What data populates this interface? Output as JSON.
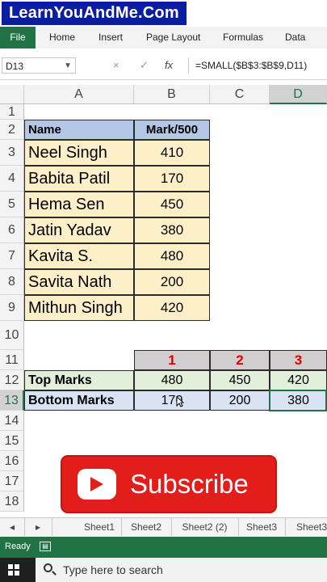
{
  "brand": "LearnYouAndMe.Com",
  "ribbon_tabs": [
    "File",
    "Home",
    "Insert",
    "Page Layout",
    "Formulas",
    "Data"
  ],
  "name_box": "D13",
  "formula_icons": {
    "cancel": "×",
    "enter": "✓",
    "function": "fx"
  },
  "formula": "=SMALL($B$3:$B$9,D11)",
  "columns": [
    "A",
    "B",
    "C",
    "D"
  ],
  "rows": [
    "1",
    "2",
    "3",
    "4",
    "5",
    "6",
    "7",
    "8",
    "9",
    "10",
    "11",
    "12",
    "13",
    "14",
    "15",
    "16",
    "17",
    "18"
  ],
  "table": {
    "headers": [
      "Name",
      "Mark/500"
    ],
    "rows": [
      {
        "name": "Neel Singh",
        "mark": "410"
      },
      {
        "name": "Babita Patil",
        "mark": "170"
      },
      {
        "name": "Hema Sen",
        "mark": "450"
      },
      {
        "name": "Jatin Yadav",
        "mark": "380"
      },
      {
        "name": "Kavita S.",
        "mark": "480"
      },
      {
        "name": "Savita Nath",
        "mark": "200"
      },
      {
        "name": "Mithun Singh",
        "mark": "420"
      }
    ]
  },
  "ranks": [
    "1",
    "2",
    "3"
  ],
  "top_marks": {
    "label": "Top Marks",
    "values": [
      "480",
      "450",
      "420"
    ]
  },
  "bottom_marks": {
    "label": "Bottom Marks",
    "values": [
      "170",
      "200",
      "380"
    ]
  },
  "subscribe_label": "Subscribe",
  "sheets": [
    "Sheet1",
    "Sheet2",
    "Sheet2 (2)",
    "Sheet3",
    "Sheet3"
  ],
  "status": {
    "ready": "Ready"
  },
  "taskbar": {
    "search_placeholder": "Type here to search"
  },
  "colors": {
    "excel_green": "#217346",
    "subscribe_red": "#e31d1a",
    "brand_blue": "#0b1ea3"
  }
}
